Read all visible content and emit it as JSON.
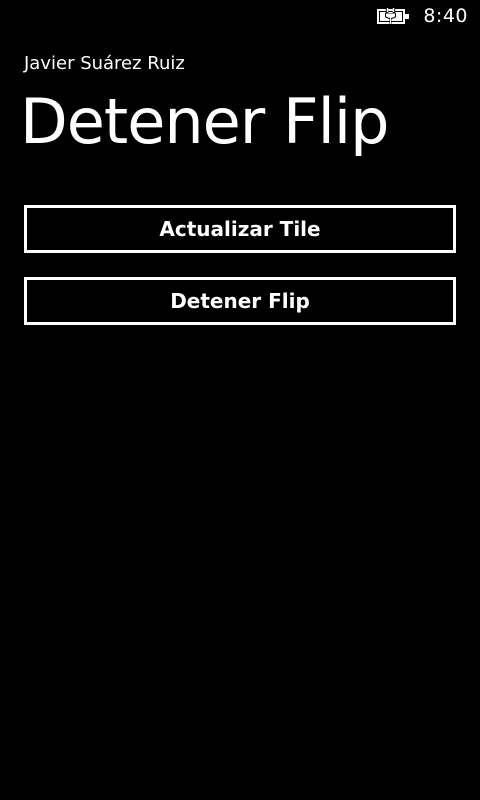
{
  "status_bar": {
    "time": "8:40",
    "battery_icon": "battery-charging-icon"
  },
  "header": {
    "app_title": "Javier Suárez Ruiz",
    "page_title": "Detener Flip"
  },
  "buttons": {
    "update_tile_label": "Actualizar Tile",
    "stop_flip_label": "Detener Flip"
  },
  "colors": {
    "background": "#000000",
    "foreground": "#ffffff"
  }
}
